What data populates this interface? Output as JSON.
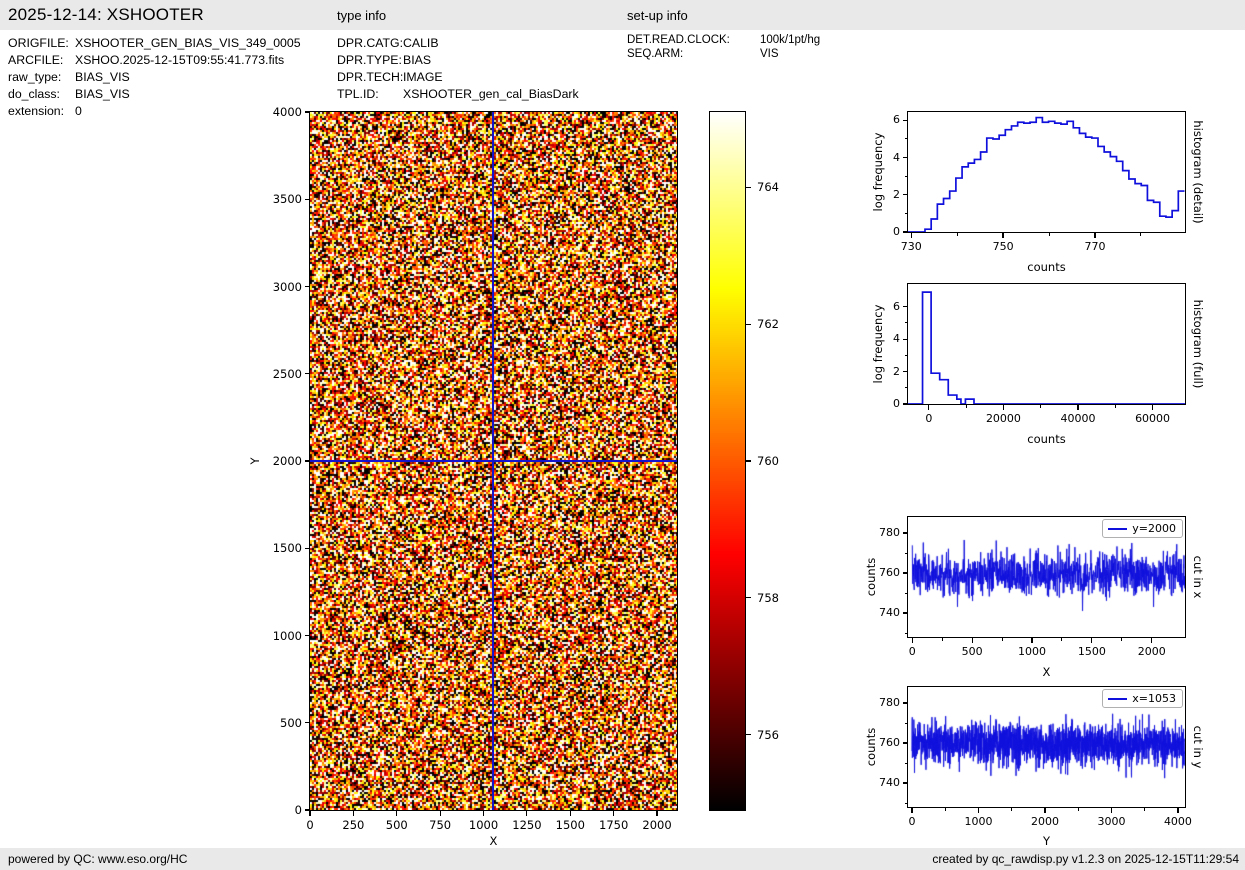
{
  "header": {
    "title": "2025-12-14: XSHOOTER",
    "type_info_label": "type info",
    "setup_info_label": "set-up info"
  },
  "file_info": {
    "rows": [
      {
        "label": "ORIGFILE:",
        "value": "XSHOOTER_GEN_BIAS_VIS_349_0005"
      },
      {
        "label": "ARCFILE:",
        "value": "XSHOO.2025-12-15T09:55:41.773.fits"
      },
      {
        "label": "raw_type:",
        "value": "BIAS_VIS"
      },
      {
        "label": "do_class:",
        "value": "BIAS_VIS"
      },
      {
        "label": "extension:",
        "value": "0"
      }
    ]
  },
  "type_info": {
    "rows": [
      {
        "label": "DPR.CATG:",
        "value": "CALIB"
      },
      {
        "label": "DPR.TYPE:",
        "value": "BIAS"
      },
      {
        "label": "DPR.TECH:",
        "value": "IMAGE"
      },
      {
        "label": "TPL.ID:",
        "value": "XSHOOTER_gen_cal_BiasDark"
      }
    ]
  },
  "setup_info": {
    "rows": [
      {
        "label": "DET.READ.CLOCK:",
        "value": "100k/1pt/hg"
      },
      {
        "label": "SEQ.ARM:",
        "value": "VIS"
      }
    ]
  },
  "footer": {
    "left": "powered by QC: www.eso.org/HC",
    "right": "created by qc_rawdisp.py v1.2.3 on 2025-12-15T11:29:54"
  },
  "colors": {
    "line_blue": "#1010dd",
    "crosshair_blue": "#1414cc",
    "bar_background": "#e9e9e9"
  },
  "chart_data": {
    "main_image": {
      "type": "heatmap",
      "xlabel": "X",
      "ylabel": "Y",
      "xlim": [
        0,
        2115
      ],
      "ylim": [
        0,
        4000
      ],
      "x_ticks": [
        0,
        250,
        500,
        750,
        1000,
        1250,
        1500,
        1750,
        2000
      ],
      "y_ticks": [
        0,
        500,
        1000,
        1500,
        2000,
        2500,
        3000,
        3500,
        4000
      ],
      "colormap": "hot",
      "crosshair": {
        "x": 1053,
        "y": 2000
      },
      "noise": {
        "mean": 760,
        "sigma": 5.0,
        "vmin": 754.9,
        "vmax": 765.1,
        "seed": 3
      }
    },
    "colorbar": {
      "vmin": 754.9,
      "vmax": 765.1,
      "ticks": [
        756,
        758,
        760,
        762,
        764
      ]
    },
    "hist_detail": {
      "type": "step-histogram",
      "right_label": "histogram (detail)",
      "xlabel": "counts",
      "ylabel": "log frequency",
      "xlim": [
        729.3,
        789.6
      ],
      "ylim": [
        0,
        6.45
      ],
      "x_ticks": [
        730,
        750,
        770
      ],
      "x_minor_ticks": [
        740,
        760,
        780
      ],
      "y_ticks": [
        0,
        2,
        4,
        6
      ],
      "y_minor_ticks": [
        1,
        3,
        5
      ],
      "bins_start": 733,
      "bin_width": 1.345,
      "heights": [
        0.15,
        0.7,
        1.5,
        1.8,
        2.2,
        2.9,
        3.5,
        3.7,
        3.9,
        4.3,
        5.05,
        5.0,
        5.2,
        5.5,
        5.7,
        5.9,
        5.85,
        5.9,
        6.15,
        5.9,
        5.95,
        5.85,
        5.8,
        5.95,
        5.6,
        5.3,
        5.1,
        5.05,
        4.6,
        4.3,
        4.05,
        3.8,
        3.3,
        2.85,
        2.6,
        2.5,
        1.7,
        1.6,
        0.85,
        0.8,
        1.15,
        2.2
      ]
    },
    "hist_full": {
      "type": "step-histogram",
      "right_label": "histogram (full)",
      "xlabel": "counts",
      "ylabel": "log frequency",
      "xlim": [
        -5600,
        68700
      ],
      "ylim": [
        0,
        7.4
      ],
      "x_ticks": [
        0,
        20000,
        40000,
        60000
      ],
      "x_minor_ticks": [
        10000,
        30000,
        50000
      ],
      "y_ticks": [
        0,
        2,
        4,
        6
      ],
      "y_minor_ticks": [
        1,
        3,
        5
      ],
      "step_edges": [
        -1700,
        600,
        2900,
        5200,
        7500,
        8600,
        9800,
        12100
      ],
      "step_heights": [
        6.9,
        1.9,
        1.5,
        0.55,
        0.3,
        0,
        0.3,
        0
      ]
    },
    "cut_x": {
      "type": "line",
      "legend": "y=2000",
      "right_label": "cut in x",
      "xlabel": "X",
      "ylabel": "counts",
      "xlim": [
        -36,
        2278
      ],
      "ylim": [
        728,
        788
      ],
      "x_ticks": [
        0,
        500,
        1000,
        1500,
        2000
      ],
      "x_minor_ticks": [
        250,
        750,
        1250,
        1750
      ],
      "y_ticks": [
        740,
        760,
        780
      ],
      "y_minor_ticks": [
        730,
        750,
        770
      ],
      "noise": {
        "mean": 759.5,
        "sigma": 5.2,
        "points": 1140,
        "x_start": 0,
        "x_end": 2275,
        "seed": 7
      }
    },
    "cut_y": {
      "type": "line",
      "legend": "x=1053",
      "right_label": "cut in y",
      "xlabel": "Y",
      "ylabel": "counts",
      "xlim": [
        -60,
        4106
      ],
      "ylim": [
        728,
        788
      ],
      "x_ticks": [
        0,
        1000,
        2000,
        3000,
        4000
      ],
      "x_minor_ticks": [
        500,
        1500,
        2500,
        3500
      ],
      "y_ticks": [
        740,
        760,
        780
      ],
      "y_minor_ticks": [
        730,
        750,
        770
      ],
      "noise": {
        "mean": 759.5,
        "sigma": 5.2,
        "points": 2048,
        "x_start": 0,
        "x_end": 4096,
        "seed": 13
      }
    }
  }
}
